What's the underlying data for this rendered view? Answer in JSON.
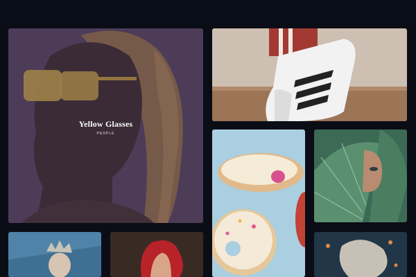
{
  "featured": {
    "title": "Yellow Glasses",
    "category": "PEOPLE"
  },
  "gallery": {
    "items": [
      {
        "subject": "woman-yellow-glasses"
      },
      {
        "subject": "superstar-sneaker"
      },
      {
        "subject": "floating-donuts"
      },
      {
        "subject": "face-behind-leaf"
      },
      {
        "subject": "crowned-figure"
      },
      {
        "subject": "red-hair-woman"
      },
      {
        "subject": "floating-hair-water"
      }
    ]
  },
  "colors": {
    "background": "#0b0d16",
    "overlay": "#503c64"
  }
}
